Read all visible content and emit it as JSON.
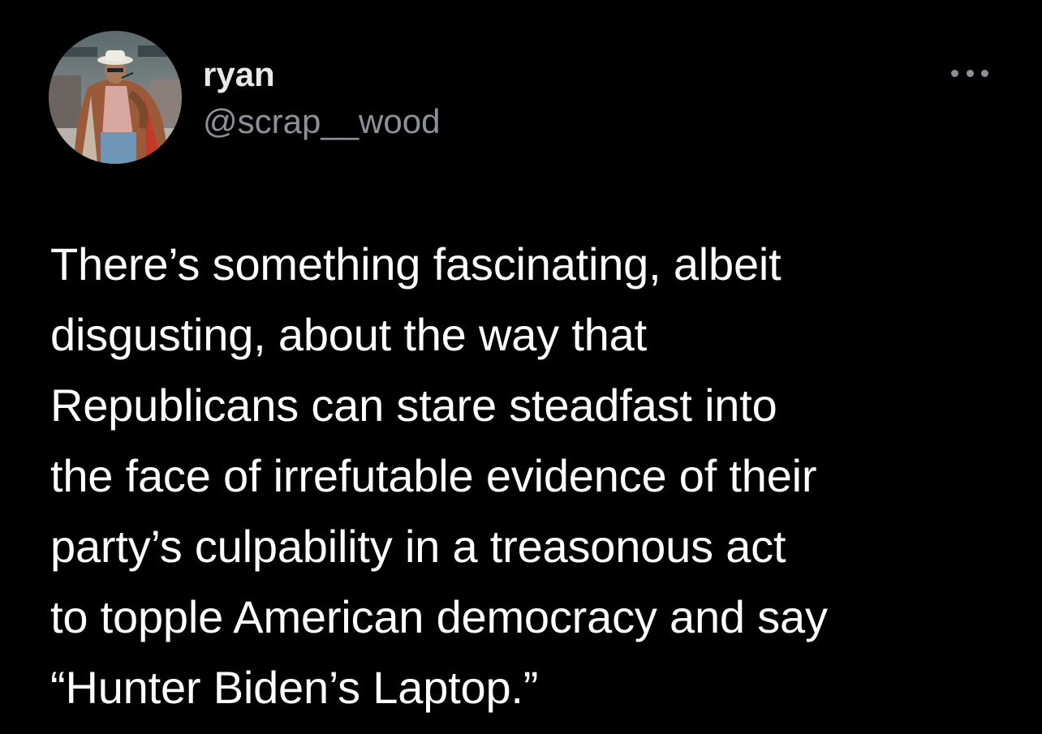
{
  "author": {
    "display_name": "ryan",
    "handle": "@scrap__wood",
    "avatar": "avatar-photo"
  },
  "more_menu": {
    "icon": "more-horizontal-icon"
  },
  "tweet": {
    "lines": [
      "There’s something fascinating, albeit",
      "disgusting, about the way that",
      "Republicans can stare steadfast into",
      "the face of irrefutable evidence of their",
      "party’s culpability in a treasonous act",
      "to topple American democracy and say",
      "“Hunter Biden’s Laptop.”"
    ]
  },
  "colors": {
    "background": "#000000",
    "text": "#ffffff",
    "secondary": "#8b9197"
  }
}
